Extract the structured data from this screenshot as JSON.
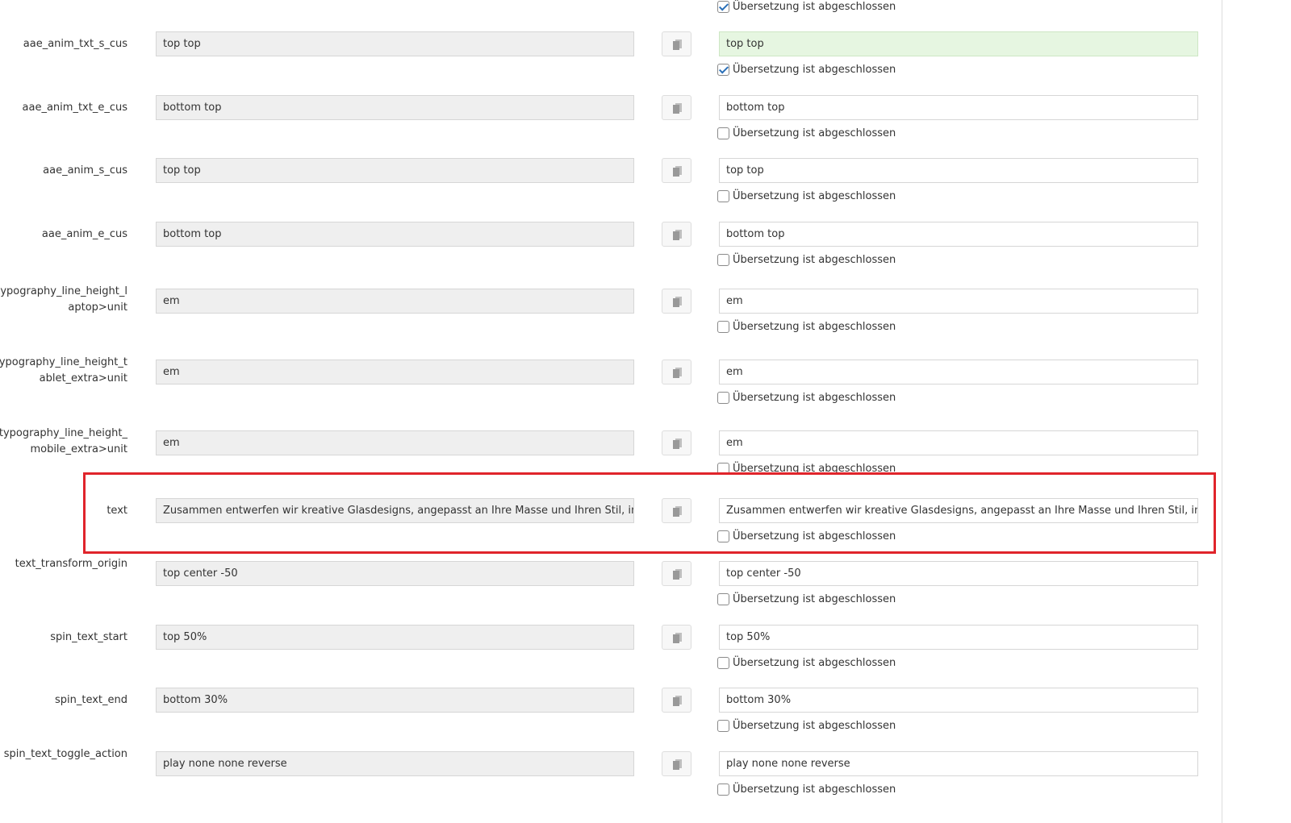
{
  "checkbox_label": "Übersetzung ist abgeschlossen",
  "top_checkbox_checked": true,
  "rows": [
    {
      "key": "aae_anim_txt_s_cus",
      "source": "top top",
      "target": "top top",
      "done": true
    },
    {
      "key": "aae_anim_txt_e_cus",
      "source": "bottom top",
      "target": "bottom top",
      "done": false
    },
    {
      "key": "aae_anim_s_cus",
      "source": "top top",
      "target": "top top",
      "done": false
    },
    {
      "key": "aae_anim_e_cus",
      "source": "bottom top",
      "target": "bottom top",
      "done": false
    },
    {
      "key": "typography_line_height_laptop>unit",
      "source": "em",
      "target": "em",
      "done": false
    },
    {
      "key": "typography_line_height_tablet_extra>unit",
      "source": "em",
      "target": "em",
      "done": false
    },
    {
      "key": "typography_line_height_mobile_extra>unit",
      "source": "em",
      "target": "em",
      "done": false
    },
    {
      "key": "text",
      "source": "Zusammen entwerfen wir kreative Glasdesigns, angepasst an Ihre Masse und Ihren Stil, in enger",
      "target": "Zusammen entwerfen wir kreative Glasdesigns, angepasst an Ihre Masse und Ihren Stil, in enger",
      "done": false,
      "highlighted": true
    },
    {
      "key": "text_transform_origin",
      "source": "top center -50",
      "target": "top center -50",
      "done": false
    },
    {
      "key": "spin_text_start",
      "source": "top 50%",
      "target": "top 50%",
      "done": false
    },
    {
      "key": "spin_text_end",
      "source": "bottom 30%",
      "target": "bottom 30%",
      "done": false
    },
    {
      "key": "spin_text_toggle_action",
      "source": "play none none reverse",
      "target": "play none none reverse",
      "done": false
    }
  ]
}
